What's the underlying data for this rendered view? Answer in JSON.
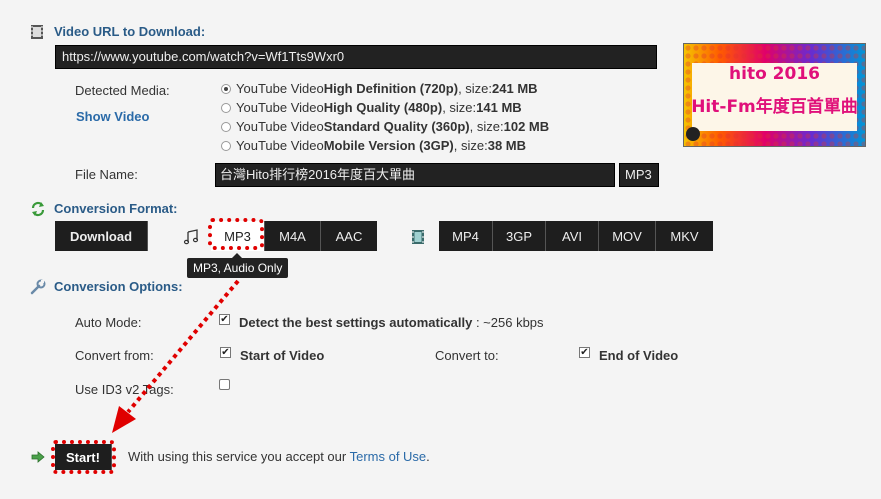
{
  "header": {
    "title": "Video URL to Download:",
    "url": "https://www.youtube.com/watch?v=Wf1Tts9Wxr0"
  },
  "media": {
    "label": "Detected Media:",
    "show_video": "Show Video",
    "options": [
      {
        "prefix": "YouTube Video ",
        "bold": "High Definition (720p)",
        "suffix": ", size: ",
        "size": "241 MB",
        "checked": true
      },
      {
        "prefix": "YouTube Video ",
        "bold": "High Quality (480p)",
        "suffix": ", size: ",
        "size": "141 MB",
        "checked": false
      },
      {
        "prefix": "YouTube Video ",
        "bold": "Standard Quality (360p)",
        "suffix": ", size: ",
        "size": "102 MB",
        "checked": false
      },
      {
        "prefix": "YouTube Video ",
        "bold": "Mobile Version (3GP)",
        "suffix": ", size: ",
        "size": "38 MB",
        "checked": false
      }
    ]
  },
  "file": {
    "label": "File Name:",
    "name": "台灣Hito排行榜2016年度百大單曲",
    "ext": "MP3"
  },
  "thumbnail": {
    "line1": "hito 2016",
    "line2": "Hit-Fm年度百首單曲"
  },
  "conversion": {
    "title": "Conversion Format:",
    "download": "Download",
    "audio": [
      "MP3",
      "M4A",
      "AAC"
    ],
    "video": [
      "MP4",
      "3GP",
      "AVI",
      "MOV",
      "MKV"
    ],
    "tooltip": "MP3, Audio Only"
  },
  "options": {
    "title": "Conversion Options:",
    "auto_mode_label": "Auto Mode:",
    "auto_mode_text": "Detect the best settings automatically",
    "auto_mode_rate": " : ~256 kbps",
    "convert_from_label": "Convert from:",
    "convert_from_value": "Start of Video",
    "convert_to_label": "Convert to:",
    "convert_to_value": "End of Video",
    "id3_label": "Use ID3 v2 Tags:"
  },
  "footer": {
    "start": "Start!",
    "text": "With using this service you accept our ",
    "terms": "Terms of Use",
    "period": "."
  },
  "colors": {
    "title": "#2a5b87",
    "link": "#2a6aa8",
    "highlight": "#e00000",
    "button": "#1e1e1e"
  }
}
